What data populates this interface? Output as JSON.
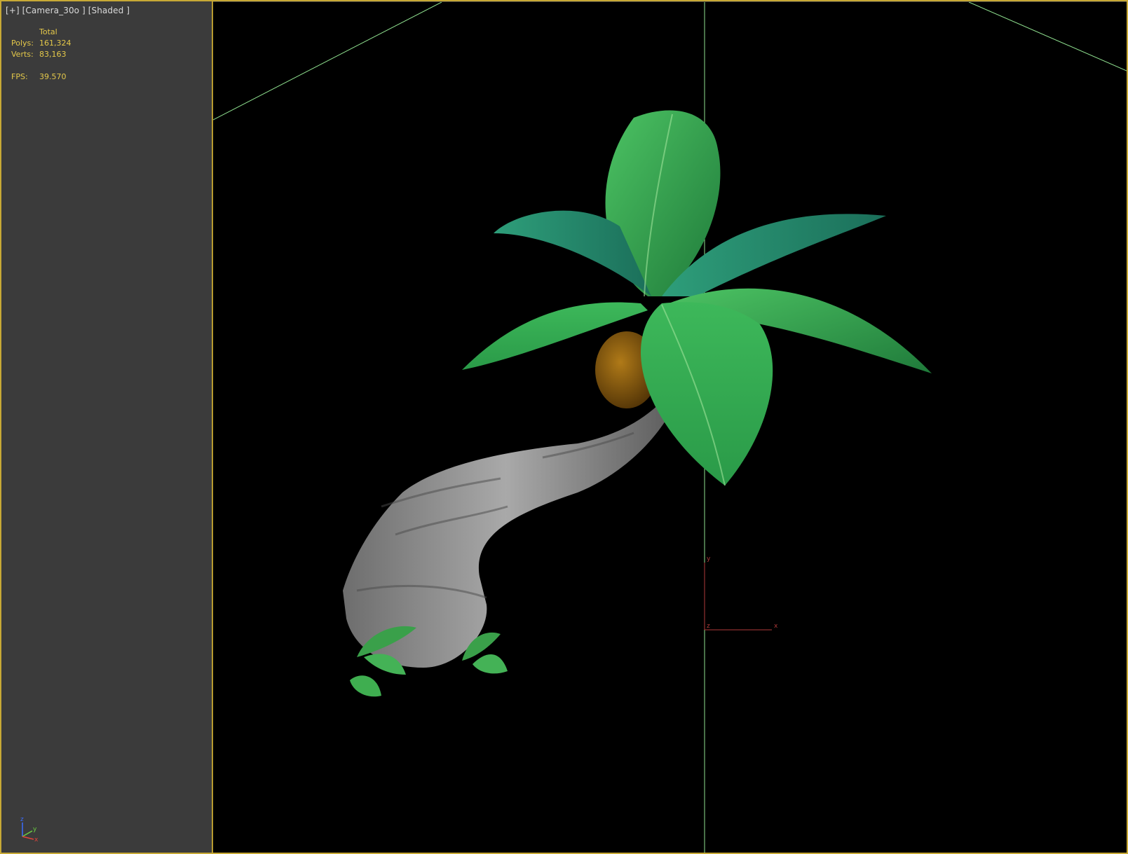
{
  "viewport": {
    "label": "[+] [Camera_30o ] [Shaded ]"
  },
  "stats": {
    "header": "Total",
    "polys_label": "Polys:",
    "polys_value": "161,324",
    "verts_label": "Verts:",
    "verts_value": "83,163",
    "fps_label": "FPS:",
    "fps_value": "39.570"
  },
  "gizmo": {
    "x_label": "x",
    "y_label": "y",
    "z_label": "z"
  },
  "corner_axes": {
    "x": "x",
    "y": "y",
    "z": "z"
  },
  "colors": {
    "frame_border": "#c8a935",
    "stats_text": "#e4c84a",
    "grid_line": "#7fe07f",
    "leaf_green": "#3aa04a",
    "trunk_gray": "#8a8a8a",
    "coconut": "#8a5a10"
  }
}
